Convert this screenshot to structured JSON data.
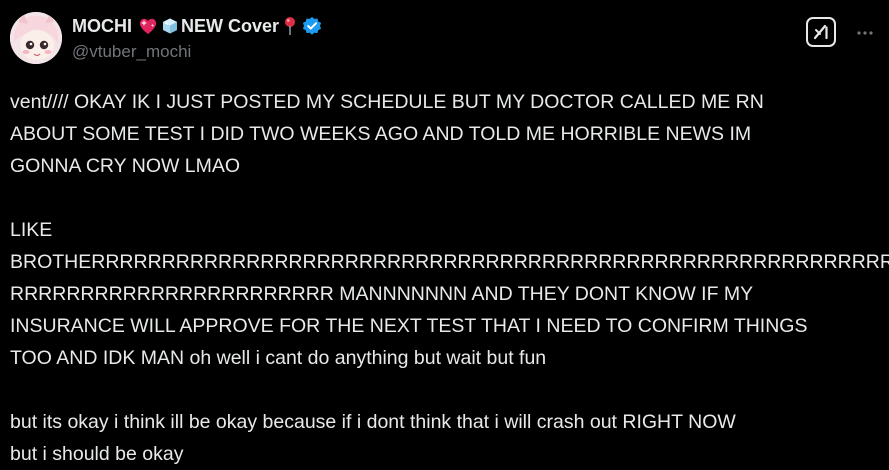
{
  "author": {
    "name": "MOCHI",
    "name_suffix": "NEW Cover",
    "handle": "@vtuber_mochi",
    "verified_color": "#1d9bf0",
    "emojis": [
      "sparkling-heart-icon",
      "ice-cube-icon",
      "round-pushpin-icon"
    ]
  },
  "actions": {
    "grok_icon": "grok-icon",
    "more_icon": "more-icon"
  },
  "tweet": {
    "lines": [
      "vent//// OKAY IK I JUST POSTED MY SCHEDULE BUT MY DOCTOR CALLED ME RN",
      "ABOUT SOME TEST I DID TWO WEEKS AGO AND TOLD ME HORRIBLE NEWS IM",
      "GONNA CRY NOW LMAO",
      "",
      "LIKE",
      "BROTHERRRRRRRRRRRRRRRRRRRRRRRRRRRRRRRRRRRRRRRRRRRRRRRRRRRRRRRRR",
      "RRRRRRRRRRRRRRRRRRRRRRR MANNNNNNN AND THEY DONT KNOW IF MY",
      "INSURANCE WILL APPROVE FOR THE NEXT TEST THAT I NEED TO CONFIRM THINGS",
      "TOO AND IDK MAN oh well i cant do anything but wait but fun",
      "",
      "but its okay i think ill be okay because if i dont think that i will crash out RIGHT NOW",
      "but i should be okay"
    ]
  },
  "colors": {
    "background": "#000000",
    "text": "#e7e9ea",
    "secondary": "#71767b"
  }
}
